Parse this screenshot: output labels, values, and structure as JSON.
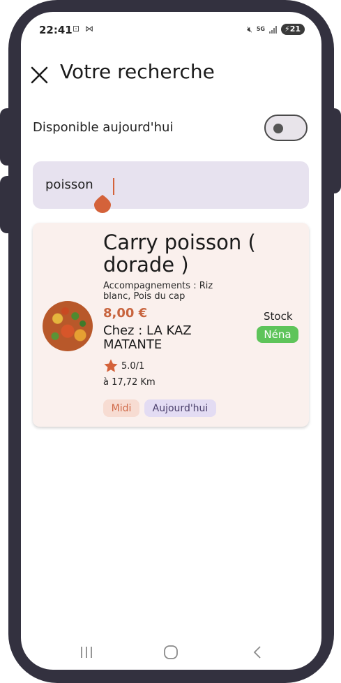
{
  "status_bar": {
    "time": "22:41",
    "left_icons": "⊡ ⋈",
    "network": "5G",
    "battery": "21"
  },
  "header": {
    "title": "Votre recherche",
    "close_icon": "close-icon"
  },
  "filter": {
    "label": "Disponible aujourd'hui",
    "toggle_on": false
  },
  "search": {
    "value": "poisson",
    "accent_color": "#d4623a"
  },
  "results": [
    {
      "name": "Carry poisson ( dorade )",
      "sides": "Accompagnements : Riz blanc, Pois du cap",
      "price": "8,00 €",
      "vendor": "Chez : LA KAZ MATANTE",
      "rating": "5.0/1",
      "distance": "à 17,72 Km",
      "stock_label": "Stock",
      "stock_value": "Néna",
      "tags": [
        "Midi",
        "Aujourd'hui"
      ]
    }
  ],
  "colors": {
    "frame": "#33313f",
    "search_bg": "#e7e2ef",
    "card_bg": "#faf0ed",
    "price": "#c8643e",
    "stock_badge": "#5ec45a",
    "tag_midi_bg": "#f7dcd2",
    "tag_today_bg": "#e3dcf3"
  },
  "navbar": {
    "icons": [
      "recents-icon",
      "home-icon",
      "back-icon"
    ]
  }
}
